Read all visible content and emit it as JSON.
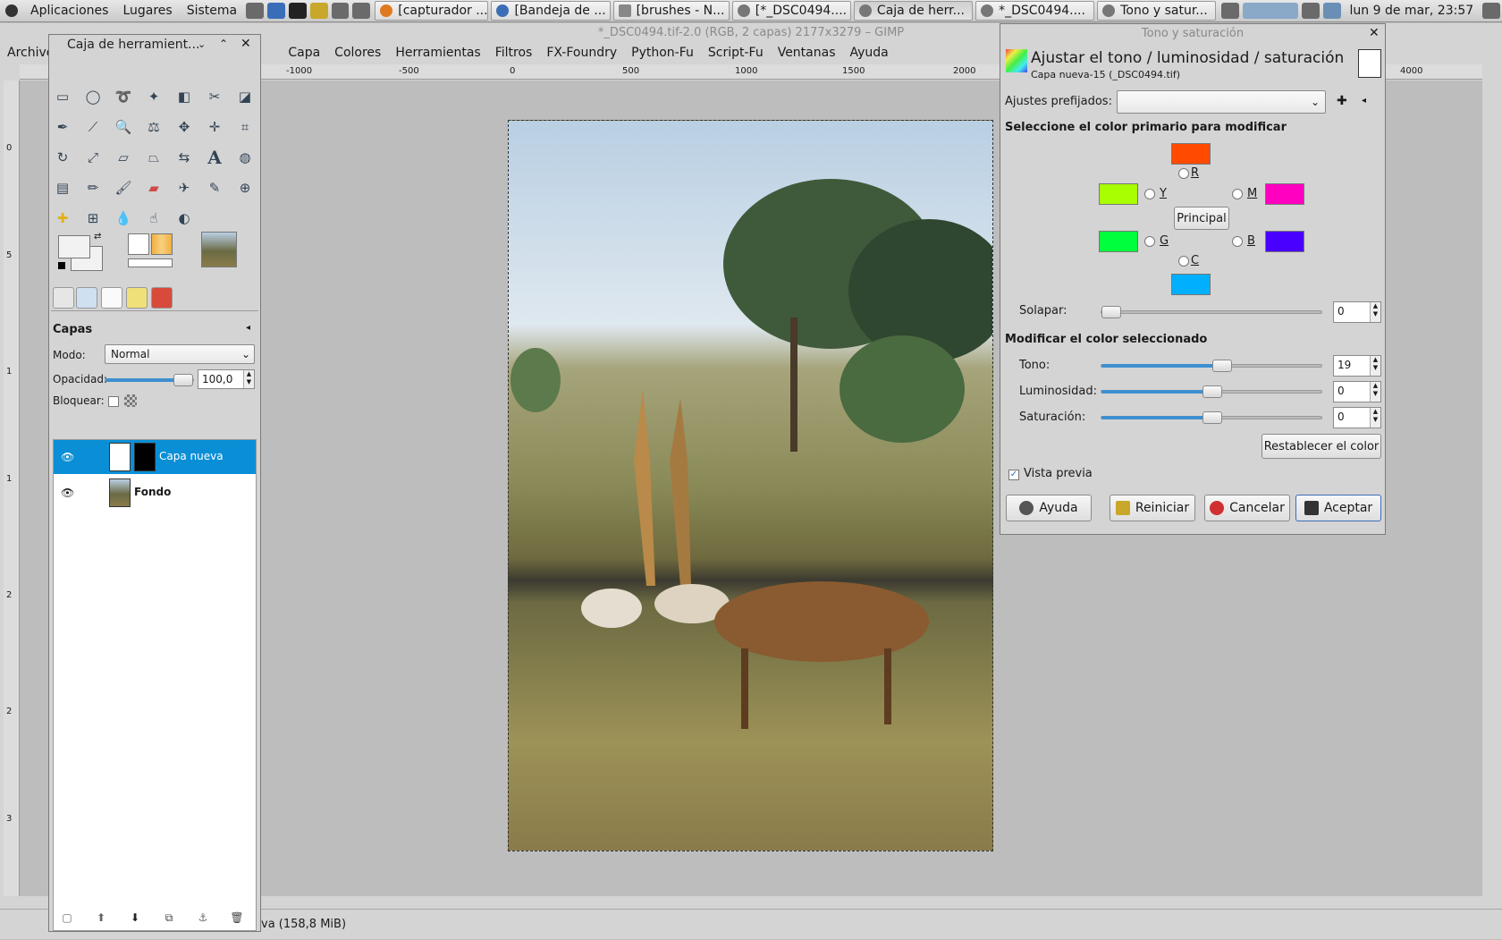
{
  "panel": {
    "menus": [
      "Aplicaciones",
      "Lugares",
      "Sistema"
    ],
    "tasks": [
      "[capturador ...",
      "[Bandeja de ...",
      "[brushes - N...",
      "[*_DSC0494....",
      "Caja de herr...",
      "*_DSC0494....",
      "Tono y satur..."
    ],
    "clock": "lun  9 de mar, 23:57"
  },
  "gimp": {
    "title": "*_DSC0494.tif-2.0 (RGB, 2 capas) 2177x3279 – GIMP",
    "menus": [
      "Archivo",
      "Capa",
      "Colores",
      "Herramientas",
      "Filtros",
      "FX-Foundry",
      "Python-Fu",
      "Script-Fu",
      "Ventanas",
      "Ayuda"
    ],
    "ruler_ticks": [
      "-1000",
      "-500",
      "0",
      "500",
      "1000",
      "1500",
      "2000",
      "4000"
    ],
    "vruler_ticks": [
      "0",
      "5",
      "1",
      "1",
      "2",
      "2",
      "3"
    ],
    "status": "va (158,8 MiB)"
  },
  "toolbox": {
    "title": "Caja de herramient...",
    "layers": {
      "heading": "Capas",
      "mode_label": "Modo:",
      "mode_value": "Normal",
      "opacity_label": "Opacidad:",
      "opacity_value": "100,0",
      "opacity_level": 1.0,
      "lock_label": "Bloquear:",
      "items": [
        {
          "name": "Capa nueva",
          "selected": true
        },
        {
          "name": "Fondo",
          "selected": false
        }
      ]
    }
  },
  "hue_dialog": {
    "window_title": "Tono y saturación",
    "heading": "Ajustar el tono / luminosidad / saturación",
    "subheading": "Capa nueva-15 (_DSC0494.tif)",
    "presets_label": "Ajustes prefijados:",
    "primary_heading": "Seleccione el color primario para modificar",
    "colors": {
      "R": "#ff4a00",
      "Y": "#a8ff00",
      "G": "#00ff3c",
      "C": "#00b0ff",
      "B": "#4a00ff",
      "M": "#ff00c0"
    },
    "radio_labels": {
      "R": "R",
      "Y": "Y",
      "G": "G",
      "C": "C",
      "B": "B",
      "M": "M"
    },
    "master_button": "Principal",
    "overlap_label": "Solapar:",
    "overlap_value": "0",
    "modify_heading": "Modificar el color seleccionado",
    "hue_label": "Tono:",
    "hue_value": "19",
    "lightness_label": "Luminosidad:",
    "lightness_value": "0",
    "saturation_label": "Saturación:",
    "saturation_value": "0",
    "reset_color_button": "Restablecer el color",
    "preview_label": "Vista previa",
    "buttons": {
      "help": "Ayuda",
      "reset": "Reiniciar",
      "cancel": "Cancelar",
      "ok": "Aceptar"
    }
  }
}
